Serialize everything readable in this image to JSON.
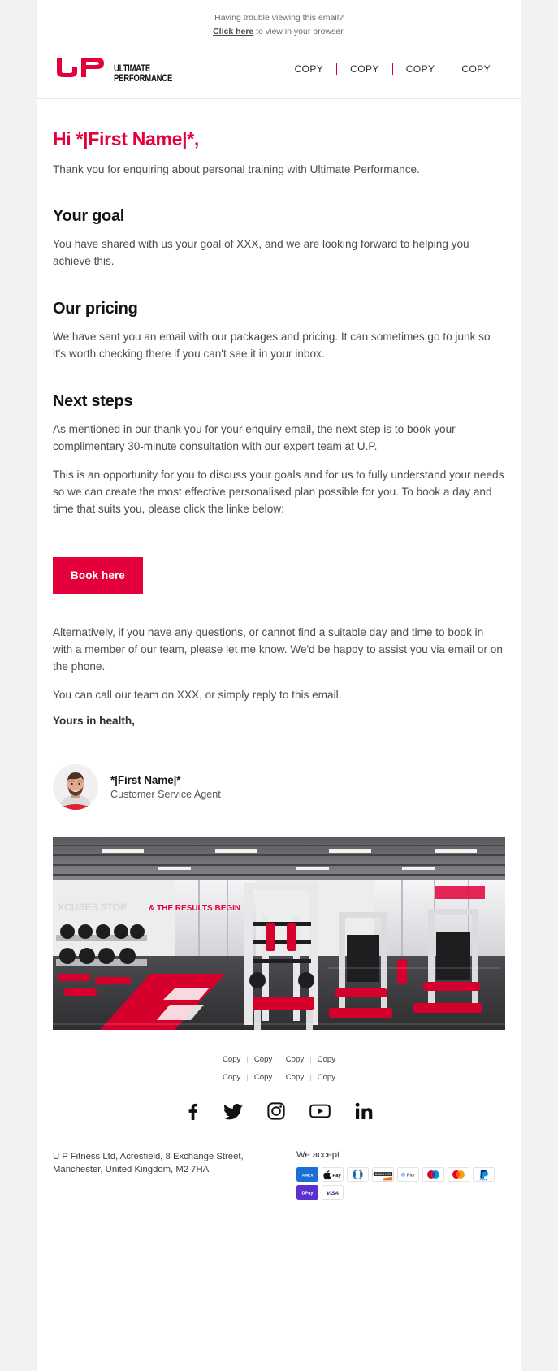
{
  "preheader": {
    "line1": "Having trouble viewing this email?",
    "link_text": "Click here",
    "line2_rest": " to view in your browser."
  },
  "header": {
    "logo": {
      "mark": "up-logo-mark",
      "line1": "ULTIMATE",
      "line2": "PERFORMANCE"
    },
    "nav_items": [
      {
        "label": "COPY"
      },
      {
        "label": "COPY"
      },
      {
        "label": "COPY"
      },
      {
        "label": "COPY"
      }
    ]
  },
  "body": {
    "greeting": "Hi *|First Name|*,",
    "intro": "Thank you for enquiring about personal training with Ultimate Performance.",
    "sections": [
      {
        "heading": "Your goal",
        "paragraphs": [
          "You have shared with us your goal of XXX, and we are looking forward to helping you achieve this."
        ]
      },
      {
        "heading": "Our pricing",
        "paragraphs": [
          "We have sent you an email with our packages and pricing. It can sometimes go to junk so it's worth checking there if you can't see it in your inbox."
        ]
      },
      {
        "heading": "Next steps",
        "paragraphs": [
          "As mentioned in our thank you for your enquiry email, the next step is to book your complimentary 30-minute consultation with our expert team at U.P.",
          "This is an opportunity for you to discuss your goals and for us to fully understand your needs so we can create the most effective personalised plan possible for you. To book a day and time that suits you, please click the linke below:"
        ]
      }
    ],
    "cta_label": "Book here",
    "closing_paragraphs": [
      "Alternatively, if you have any questions, or cannot find a suitable day and time to book in with a member of our team, please let me know. We'd be happy to assist you via email or on the phone.",
      "You can call our team on XXX, or simply reply to this email."
    ],
    "signoff": "Yours in health,"
  },
  "agent": {
    "avatar_icon": "agent-avatar-photo",
    "name": "*|First Name|*",
    "role": "Customer Service Agent"
  },
  "hero": {
    "image_name": "gym-interior-photo",
    "alt": "Ultimate Performance gym interior with red flooring and equipment"
  },
  "footer": {
    "link_rows": [
      [
        "Copy",
        "Copy",
        "Copy",
        "Copy"
      ],
      [
        "Copy",
        "Copy",
        "Copy",
        "Copy"
      ]
    ],
    "separator": "|",
    "socials": [
      {
        "name": "facebook-icon"
      },
      {
        "name": "twitter-icon"
      },
      {
        "name": "instagram-icon"
      },
      {
        "name": "youtube-icon"
      },
      {
        "name": "linkedin-icon"
      }
    ],
    "address": "U P Fitness Ltd, Acresfield, 8 Exchange Street, Manchester, United Kingdom, M2 7HA",
    "accept_label": "We accept",
    "payments": [
      {
        "name": "amex-icon",
        "label": "AMEX"
      },
      {
        "name": "apple-pay-icon",
        "label": "Pay"
      },
      {
        "name": "diners-club-icon",
        "label": "DC"
      },
      {
        "name": "discover-icon",
        "label": "DISCOVER"
      },
      {
        "name": "google-pay-icon",
        "label": "G Pay"
      },
      {
        "name": "maestro-icon",
        "label": "Maestro"
      },
      {
        "name": "mastercard-icon",
        "label": "Mastercard"
      },
      {
        "name": "paypal-icon",
        "label": "PayPal"
      },
      {
        "name": "dpay-icon",
        "label": "DPay"
      },
      {
        "name": "visa-icon",
        "label": "VISA"
      }
    ]
  },
  "colors": {
    "brand_red": "#E4003A",
    "text_dark": "#131316",
    "text_body": "#4B4B51",
    "page_bg": "#F2F2F2"
  }
}
